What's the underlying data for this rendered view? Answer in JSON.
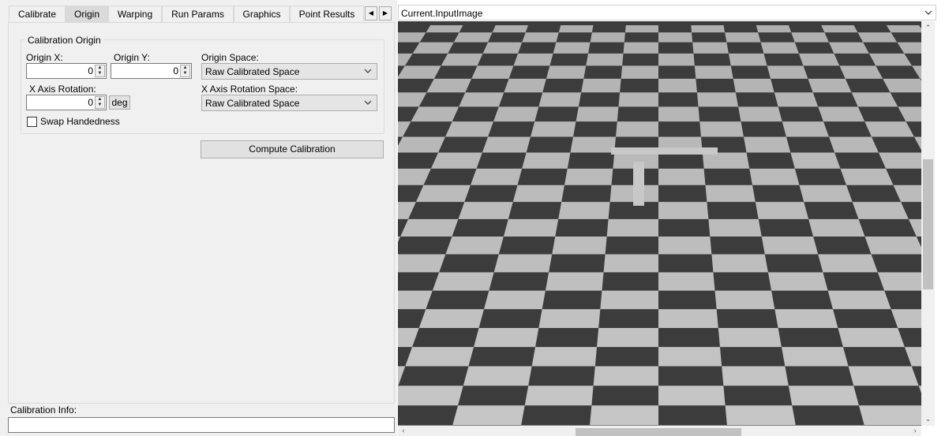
{
  "tabs": [
    {
      "label": "Calibrate",
      "active": false
    },
    {
      "label": "Origin",
      "active": true
    },
    {
      "label": "Warping",
      "active": false
    },
    {
      "label": "Run Params",
      "active": false
    },
    {
      "label": "Graphics",
      "active": false
    },
    {
      "label": "Point Results",
      "active": false
    }
  ],
  "tab_scroll": {
    "left_icon": "arrow-left",
    "right_icon": "arrow-right"
  },
  "origin_group": {
    "title": "Calibration Origin",
    "origin_x_label": "Origin X:",
    "origin_x_value": "0",
    "origin_y_label": "Origin Y:",
    "origin_y_value": "0",
    "origin_space_label": "Origin Space:",
    "origin_space_value": "Raw Calibrated Space",
    "x_axis_rotation_label": "X Axis Rotation:",
    "x_axis_rotation_value": "0",
    "x_axis_rotation_unit": "deg",
    "x_axis_rotation_space_label": "X Axis Rotation Space:",
    "x_axis_rotation_space_value": "Raw Calibrated Space",
    "swap_handedness_label": "Swap Handedness",
    "swap_handedness_checked": false
  },
  "compute_button_label": "Compute Calibration",
  "calibration_info_label": "Calibration Info:",
  "calibration_info_value": "",
  "image_panel": {
    "selector_value": "Current.InputImage",
    "image_description_icon": "checkerboard-image"
  }
}
